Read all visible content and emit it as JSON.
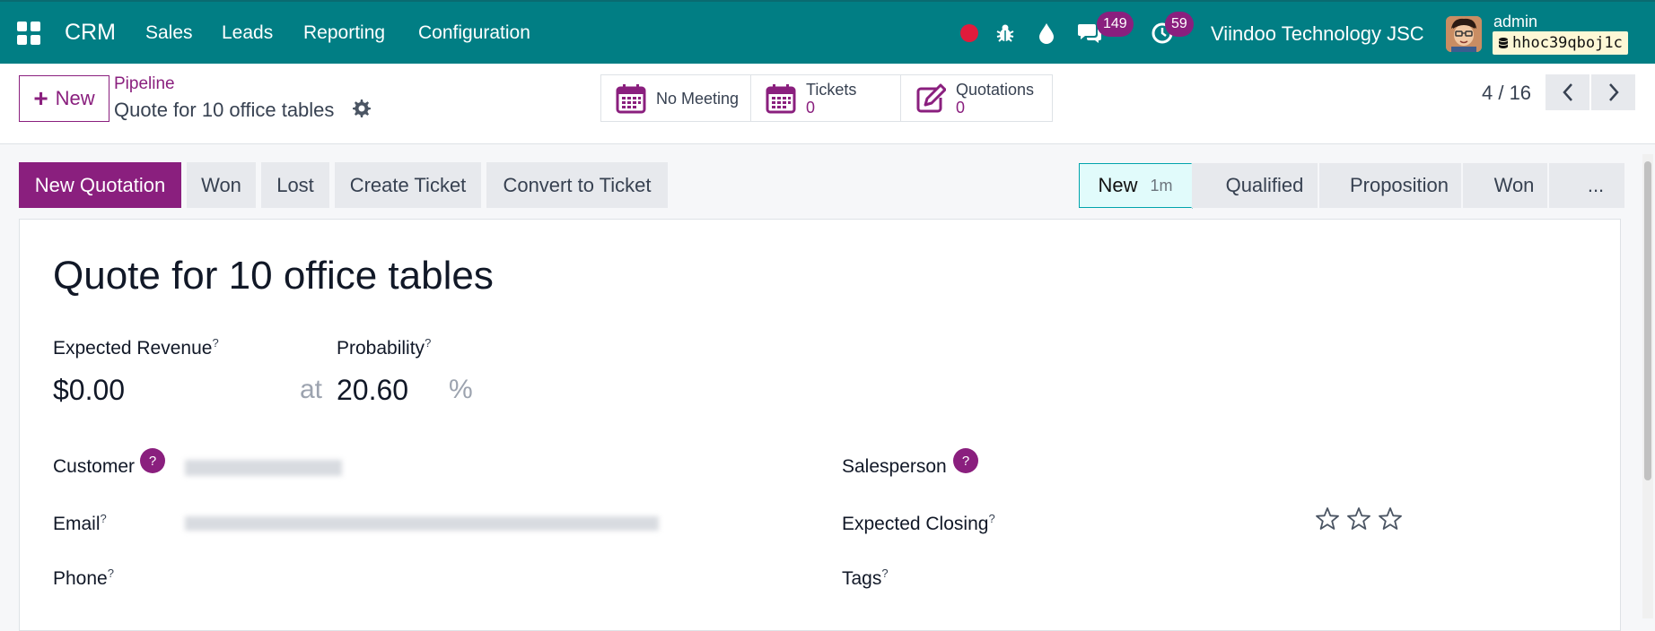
{
  "navbar": {
    "app_name": "CRM",
    "menu": [
      "Sales",
      "Leads",
      "Reporting",
      "Configuration"
    ],
    "messages_count": "149",
    "activities_count": "59",
    "company": "Viindoo Technology JSC",
    "user": "admin",
    "database": "hhoc39qboj1c",
    "colors": {
      "bar": "#017e84",
      "badge": "#8a1f7e",
      "record": "#e01b3c"
    }
  },
  "control": {
    "new_label": "New",
    "breadcrumb_parent": "Pipeline",
    "breadcrumb_current": "Quote for 10 office tables",
    "smart_buttons": [
      {
        "label": "No Meeting",
        "value": "",
        "icon": "calendar-icon"
      },
      {
        "label": "Tickets",
        "value": "0",
        "icon": "calendar-icon"
      },
      {
        "label": "Quotations",
        "value": "0",
        "icon": "pencil-square-icon"
      }
    ],
    "pager": "4 / 16"
  },
  "actions": {
    "new_quotation": "New Quotation",
    "won": "Won",
    "lost": "Lost",
    "create_ticket": "Create Ticket",
    "convert_to_ticket": "Convert to Ticket"
  },
  "stages": [
    {
      "label": "New",
      "time": "1m",
      "active": true
    },
    {
      "label": "Qualified"
    },
    {
      "label": "Proposition"
    },
    {
      "label": "Won"
    },
    {
      "label": "..."
    }
  ],
  "form": {
    "title": "Quote for 10 office tables",
    "expected_revenue_label": "Expected Revenue",
    "expected_revenue": "$0.00",
    "at_label": "at",
    "probability_label": "Probability",
    "probability": "20.60",
    "percent_sign": "%",
    "customer_label": "Customer",
    "email_label": "Email",
    "phone_label": "Phone",
    "salesperson_label": "Salesperson",
    "expected_closing_label": "Expected Closing",
    "tags_label": "Tags",
    "priority_stars": 0,
    "tooltip_mark": "?"
  }
}
